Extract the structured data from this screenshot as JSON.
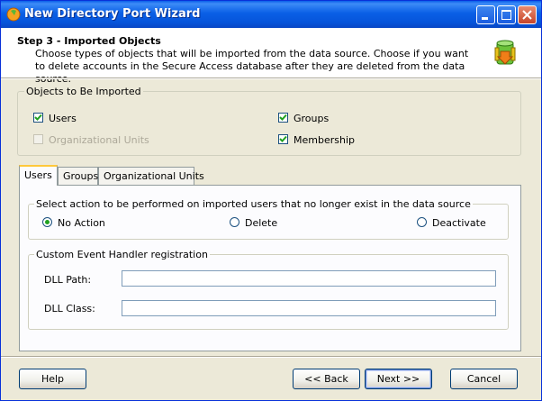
{
  "window": {
    "title": "New Directory Port Wizard"
  },
  "header": {
    "step_title": "Step 3 - Imported Objects",
    "description": "Choose types of objects that will be imported from the data source. Choose if you want to delete accounts in the Secure Access database after they are deleted from the data source.",
    "icon": "database-arrow-icon"
  },
  "objects_group": {
    "title": "Objects to Be Imported",
    "items": [
      {
        "label": "Users",
        "checked": true,
        "enabled": true
      },
      {
        "label": "Groups",
        "checked": true,
        "enabled": true
      },
      {
        "label": "Organizational Units",
        "checked": false,
        "enabled": false
      },
      {
        "label": "Membership",
        "checked": true,
        "enabled": true
      }
    ]
  },
  "tabs": [
    {
      "label": "Users",
      "active": true
    },
    {
      "label": "Groups",
      "active": false
    },
    {
      "label": "Organizational Units",
      "active": false
    }
  ],
  "action_group": {
    "title": "Select action to be performed on imported users that no longer exist in the data source",
    "options": [
      {
        "label": "No Action",
        "selected": true
      },
      {
        "label": "Delete",
        "selected": false
      },
      {
        "label": "Deactivate",
        "selected": false
      }
    ]
  },
  "handler_group": {
    "title": "Custom Event Handler registration",
    "dll_path_label": "DLL Path:",
    "dll_path_value": "",
    "dll_class_label": "DLL Class:",
    "dll_class_value": ""
  },
  "buttons": {
    "help": "Help",
    "back": "<< Back",
    "next": "Next >>",
    "cancel": "Cancel"
  },
  "colors": {
    "titlebar": "#0a5fe6",
    "face": "#ece9d8",
    "check": "#21a121"
  }
}
